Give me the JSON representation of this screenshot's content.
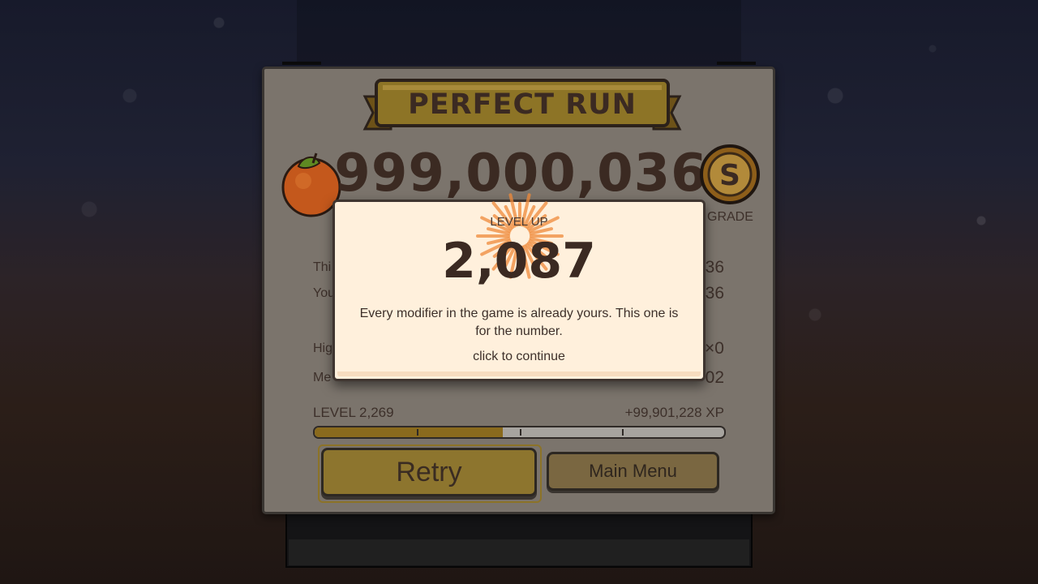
{
  "result": {
    "banner_title": "PERFECT RUN",
    "score": "999,000,036",
    "grade": "S",
    "grade_label": "GRADE",
    "stats": [
      {
        "label": "Thi",
        "value": "36"
      },
      {
        "label": "You",
        "value": "36"
      },
      {
        "label": "Hig",
        "value": "×0"
      },
      {
        "label": "Me",
        "value": "02"
      }
    ],
    "level_label": "LEVEL 2,269",
    "xp_gain": "+99,901,228 XP",
    "xp_progress": 0.46
  },
  "buttons": {
    "retry": "Retry",
    "main_menu": "Main Menu"
  },
  "levelup_modal": {
    "title": "LEVEL UP",
    "level": "2,087",
    "message": "Every modifier in the game is already yours. This one is for the number.",
    "cta": "click to continue"
  },
  "colors": {
    "panel": "#7b746c",
    "button_gold": "#8d752e",
    "modal_bg": "#fff0dc",
    "text_dark": "#3b2a22",
    "burst": "#f08a3a"
  },
  "icons": {
    "fruit": "orange-icon",
    "grade": "s-medal-icon",
    "burst": "sunburst-icon"
  }
}
